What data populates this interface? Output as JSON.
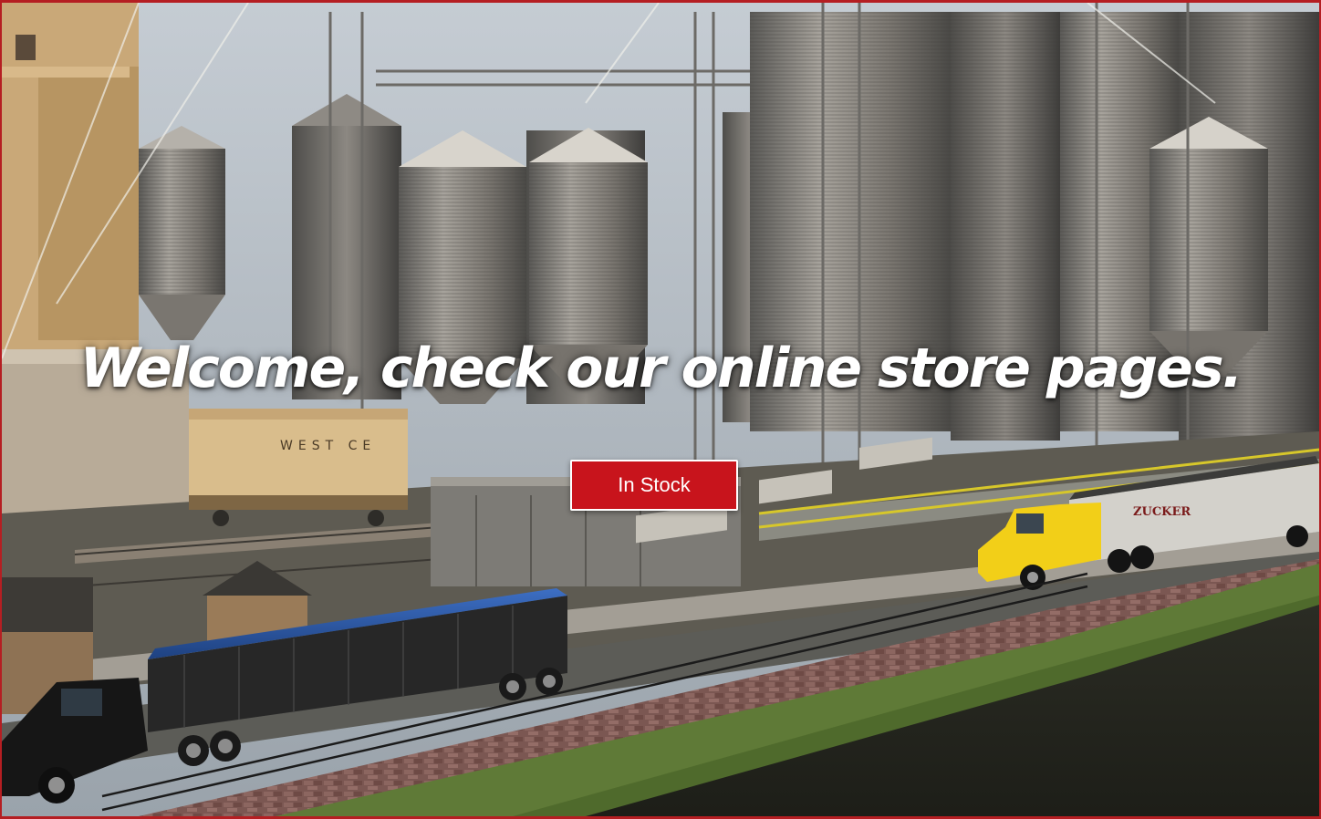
{
  "hero": {
    "headline": "Welcome, check our online store pages.",
    "cta_label": "In Stock",
    "train_car_text": "WEST CE",
    "truck_text": "ZUCKER"
  },
  "colors": {
    "frame": "#b51e22",
    "button": "#c8141c",
    "headline": "#ffffff"
  }
}
